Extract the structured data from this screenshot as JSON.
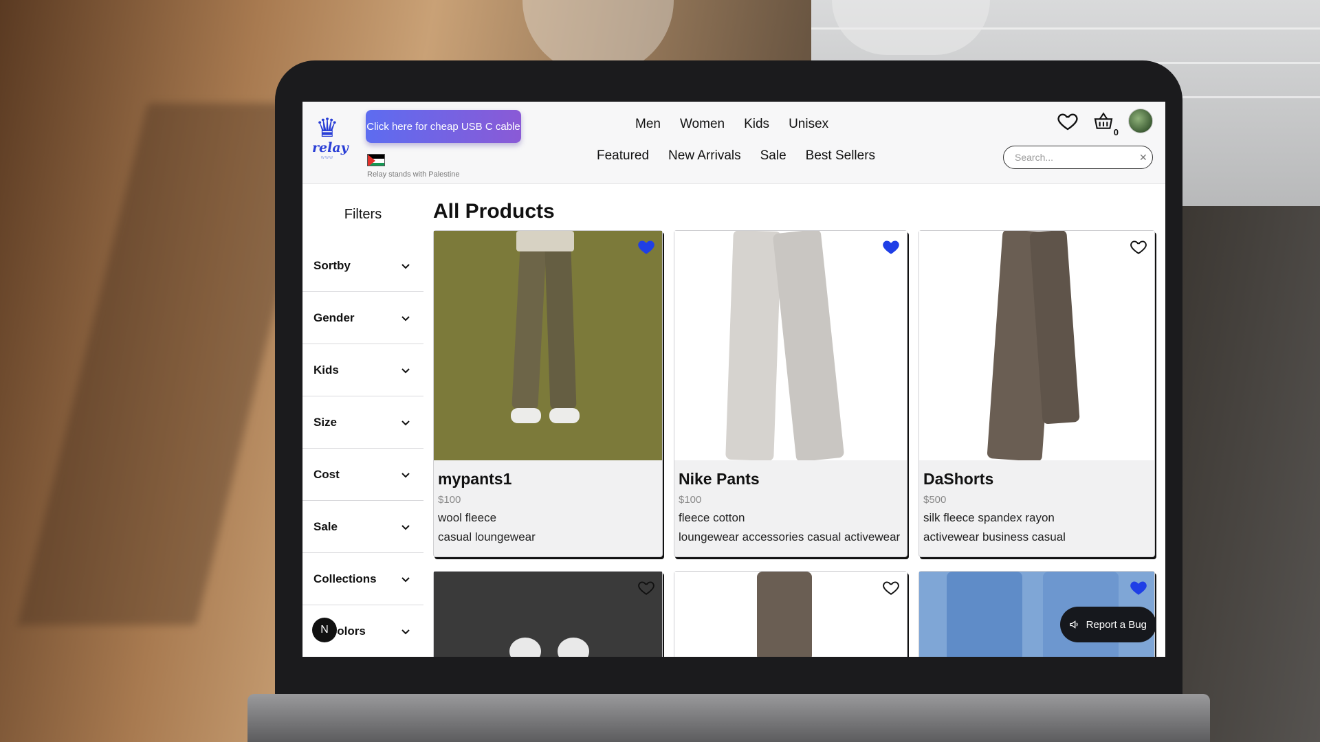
{
  "brand": {
    "name": "relay",
    "sub": "www"
  },
  "promo": {
    "label": "Click here for cheap USB C cable"
  },
  "flag_caption": "Relay stands with Palestine",
  "nav": {
    "top": [
      "Men",
      "Women",
      "Kids",
      "Unisex"
    ],
    "bottom": [
      "Featured",
      "New Arrivals",
      "Sale",
      "Best Sellers"
    ]
  },
  "cart": {
    "count": "0"
  },
  "search": {
    "placeholder": "Search..."
  },
  "sidebar": {
    "title": "Filters",
    "items": [
      "Sortby",
      "Gender",
      "Kids",
      "Size",
      "Cost",
      "Sale",
      "Collections",
      "Colors"
    ]
  },
  "badge": "N",
  "main": {
    "title": "All Products"
  },
  "products": [
    {
      "name": "mypants1",
      "price": "$100",
      "materials": "wool fleece",
      "tags": "casual loungewear",
      "favorited": true
    },
    {
      "name": "Nike Pants",
      "price": "$100",
      "materials": "fleece cotton",
      "tags": "loungewear accessories casual activewear",
      "favorited": true
    },
    {
      "name": "DaShorts",
      "price": "$500",
      "materials": "silk fleece spandex rayon",
      "tags": "activewear business casual",
      "favorited": false
    }
  ],
  "second_row": [
    {
      "favorited": false
    },
    {
      "favorited": false
    },
    {
      "favorited": true
    }
  ],
  "report_bug": {
    "label": "Report a Bug"
  },
  "colors": {
    "accent": "#2a3fd6",
    "heart_filled": "#1f3fe6"
  }
}
